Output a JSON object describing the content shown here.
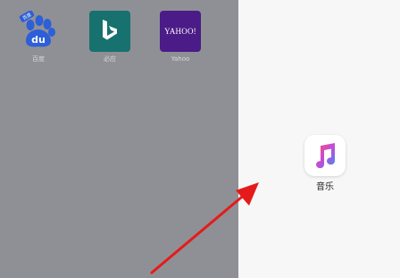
{
  "favorites": [
    {
      "label": "百度",
      "icon": "baidu-paw-icon",
      "badge": "百度"
    },
    {
      "label": "必应",
      "icon": "bing-logo-icon"
    },
    {
      "label": "Yahoo",
      "icon": "yahoo-logo-icon",
      "logo_text": "YAHOO!"
    }
  ],
  "baidu_logo_text": "du",
  "app": {
    "label": "音乐",
    "icon": "apple-music-icon"
  },
  "colors": {
    "left_pane": "#8f9095",
    "right_pane": "#f7f7f7",
    "arrow": "#e51b1b",
    "bing_tile": "#17716e",
    "yahoo_tile": "#4b1b87",
    "baidu_blue": "#2c5fd8"
  }
}
